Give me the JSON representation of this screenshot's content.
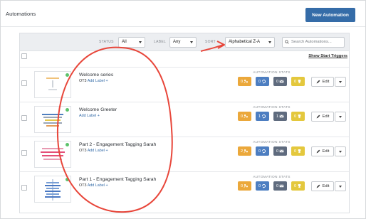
{
  "header": {
    "title": "Automations",
    "new_button_label": "New Automation"
  },
  "filters": {
    "status_label": "STATUS",
    "status_value": "All",
    "label_label": "LABEL",
    "label_value": "Any",
    "sort_label": "SORT",
    "sort_value": "Alphabetical Z-A",
    "search_placeholder": "Search Automations..."
  },
  "show_triggers": "Show Start Triggers",
  "stats_header": "AUTOMATION STATS",
  "edit_label": "Edit",
  "stat_colors": {
    "orange": "#eba83b",
    "blue": "#4d7ec1",
    "slate": "#5f6b7e",
    "yellow": "#e4c83d"
  },
  "annotation_color": "#e8463a",
  "automations": [
    {
      "name": "Welcome series",
      "tag": "OT3",
      "add_label": "Add Label +",
      "stats": [
        "0",
        "0",
        "0",
        "0"
      ]
    },
    {
      "name": "Welcome Greeter",
      "tag": "",
      "add_label": "Add Label +",
      "stats": [
        "0",
        "1",
        "1",
        "0"
      ]
    },
    {
      "name": "Part 2 - Engagement Tagging Sarah",
      "tag": "OT3",
      "add_label": "Add Label +",
      "stats": [
        "2",
        "0",
        "0",
        "0"
      ]
    },
    {
      "name": "Part 1 - Engagement Tagging Sarah",
      "tag": "OT3",
      "add_label": "Add Label +",
      "stats": [
        "0",
        "0",
        "0",
        "0"
      ]
    }
  ]
}
